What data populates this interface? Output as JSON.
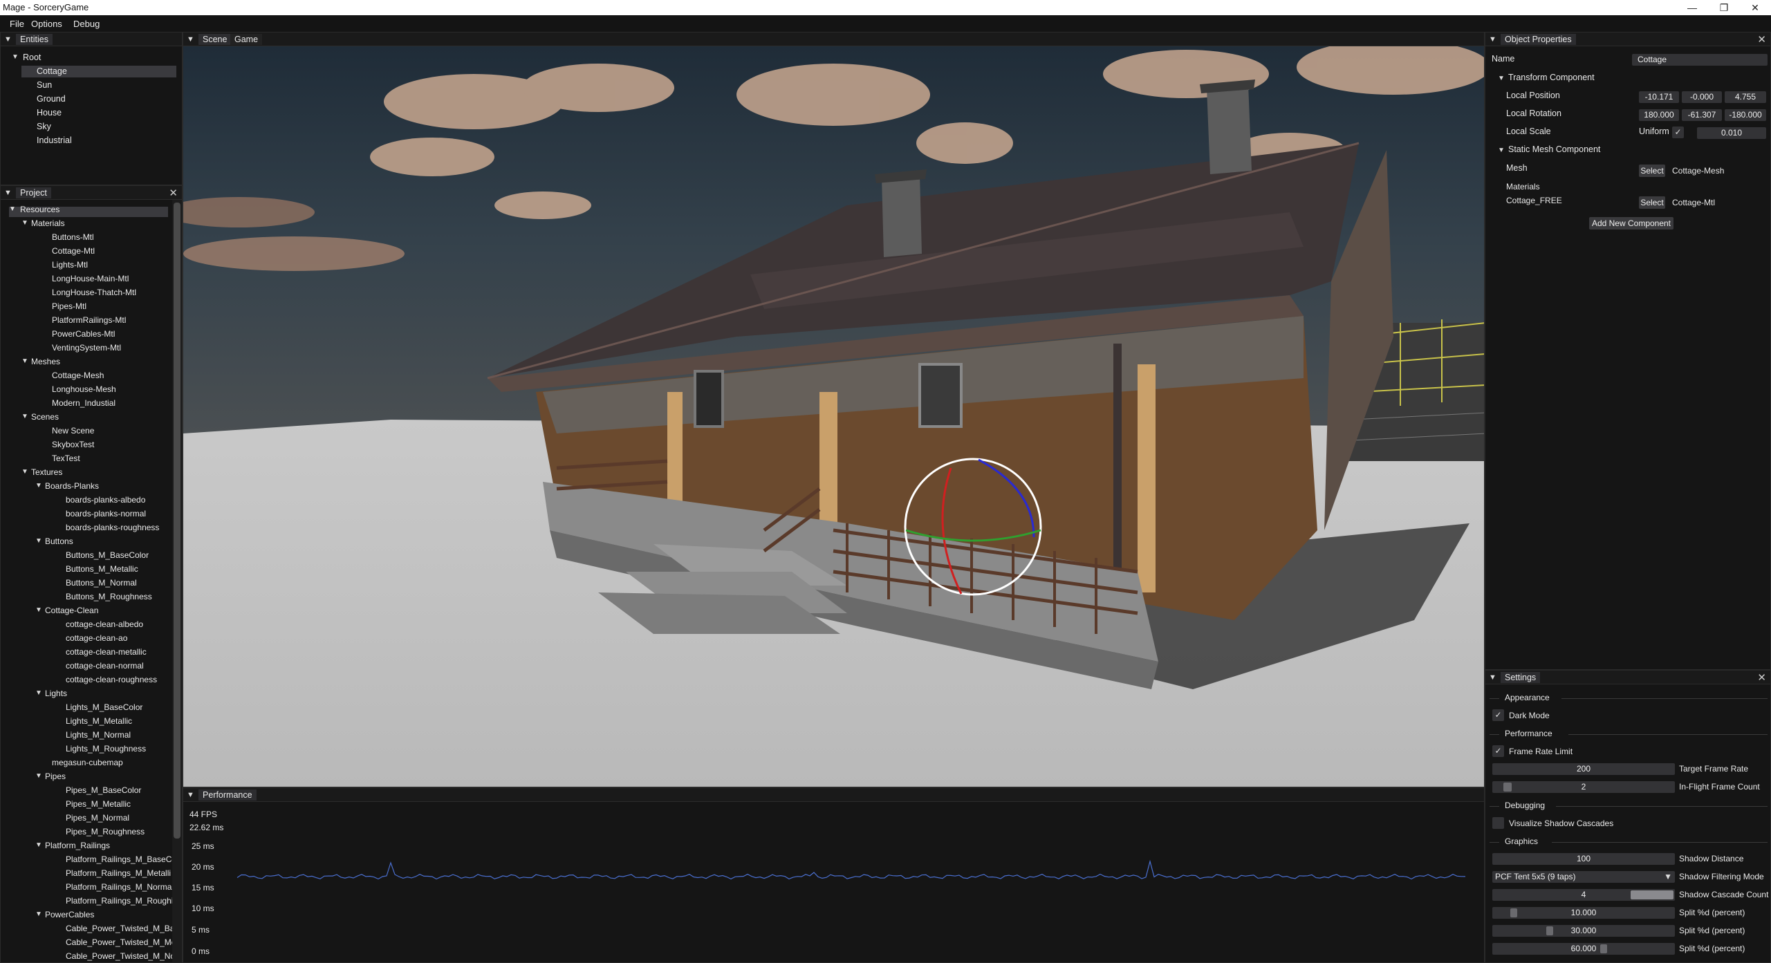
{
  "window": {
    "title": "Mage - SorceryGame",
    "minimize": "—",
    "maximize": "❐",
    "close": "✕"
  },
  "menubar": {
    "items": [
      "File",
      "Options",
      "Debug"
    ]
  },
  "entities": {
    "tab": "Entities",
    "items": [
      "Root",
      "Cottage",
      "Sun",
      "Ground",
      "House",
      "Sky",
      "Industrial"
    ],
    "selected": "Cottage"
  },
  "project": {
    "tab": "Project",
    "rows": [
      {
        "label": "Resources",
        "depth": 0,
        "arrow": true
      },
      {
        "label": "Materials",
        "depth": 1,
        "arrow": true
      },
      {
        "label": "Buttons-Mtl",
        "depth": 2
      },
      {
        "label": "Cottage-Mtl",
        "depth": 2
      },
      {
        "label": "Lights-Mtl",
        "depth": 2
      },
      {
        "label": "LongHouse-Main-Mtl",
        "depth": 2
      },
      {
        "label": "LongHouse-Thatch-Mtl",
        "depth": 2
      },
      {
        "label": "Pipes-Mtl",
        "depth": 2
      },
      {
        "label": "PlatformRailings-Mtl",
        "depth": 2
      },
      {
        "label": "PowerCables-Mtl",
        "depth": 2
      },
      {
        "label": "VentingSystem-Mtl",
        "depth": 2
      },
      {
        "label": "Meshes",
        "depth": 1,
        "arrow": true
      },
      {
        "label": "Cottage-Mesh",
        "depth": 2
      },
      {
        "label": "Longhouse-Mesh",
        "depth": 2
      },
      {
        "label": "Modern_Industial",
        "depth": 2
      },
      {
        "label": "Scenes",
        "depth": 1,
        "arrow": true
      },
      {
        "label": "New Scene",
        "depth": 2
      },
      {
        "label": "SkyboxTest",
        "depth": 2
      },
      {
        "label": "TexTest",
        "depth": 2
      },
      {
        "label": "Textures",
        "depth": 1,
        "arrow": true
      },
      {
        "label": "Boards-Planks",
        "depth": 2,
        "arrow": true
      },
      {
        "label": "boards-planks-albedo",
        "depth": 3
      },
      {
        "label": "boards-planks-normal",
        "depth": 3
      },
      {
        "label": "boards-planks-roughness",
        "depth": 3
      },
      {
        "label": "Buttons",
        "depth": 2,
        "arrow": true
      },
      {
        "label": "Buttons_M_BaseColor",
        "depth": 3
      },
      {
        "label": "Buttons_M_Metallic",
        "depth": 3
      },
      {
        "label": "Buttons_M_Normal",
        "depth": 3
      },
      {
        "label": "Buttons_M_Roughness",
        "depth": 3
      },
      {
        "label": "Cottage-Clean",
        "depth": 2,
        "arrow": true
      },
      {
        "label": "cottage-clean-albedo",
        "depth": 3
      },
      {
        "label": "cottage-clean-ao",
        "depth": 3
      },
      {
        "label": "cottage-clean-metallic",
        "depth": 3
      },
      {
        "label": "cottage-clean-normal",
        "depth": 3
      },
      {
        "label": "cottage-clean-roughness",
        "depth": 3
      },
      {
        "label": "Lights",
        "depth": 2,
        "arrow": true
      },
      {
        "label": "Lights_M_BaseColor",
        "depth": 3
      },
      {
        "label": "Lights_M_Metallic",
        "depth": 3
      },
      {
        "label": "Lights_M_Normal",
        "depth": 3
      },
      {
        "label": "Lights_M_Roughness",
        "depth": 3
      },
      {
        "label": "megasun-cubemap",
        "depth": 2
      },
      {
        "label": "Pipes",
        "depth": 2,
        "arrow": true
      },
      {
        "label": "Pipes_M_BaseColor",
        "depth": 3
      },
      {
        "label": "Pipes_M_Metallic",
        "depth": 3
      },
      {
        "label": "Pipes_M_Normal",
        "depth": 3
      },
      {
        "label": "Pipes_M_Roughness",
        "depth": 3
      },
      {
        "label": "Platform_Railings",
        "depth": 2,
        "arrow": true
      },
      {
        "label": "Platform_Railings_M_BaseCc",
        "depth": 3
      },
      {
        "label": "Platform_Railings_M_Metalli",
        "depth": 3
      },
      {
        "label": "Platform_Railings_M_Norma",
        "depth": 3
      },
      {
        "label": "Platform_Railings_M_Roughi",
        "depth": 3
      },
      {
        "label": "PowerCables",
        "depth": 2,
        "arrow": true
      },
      {
        "label": "Cable_Power_Twisted_M_Ba:",
        "depth": 3
      },
      {
        "label": "Cable_Power_Twisted_M_Me",
        "depth": 3
      },
      {
        "label": "Cable_Power_Twisted_M_No",
        "depth": 3
      }
    ]
  },
  "viewport": {
    "tabs": [
      "Scene",
      "Game"
    ],
    "active": "Scene"
  },
  "performance": {
    "tab": "Performance",
    "fps": "44 FPS",
    "frame_time": "22.62 ms",
    "axis": [
      "25 ms",
      "20 ms",
      "15 ms",
      "10 ms",
      "5 ms",
      "0 ms"
    ],
    "line_color": "#4a6fd0"
  },
  "inspector": {
    "tab": "Object Properties",
    "name_label": "Name",
    "name_value": "Cottage",
    "transform": {
      "header": "Transform Component",
      "position_label": "Local Position",
      "position": [
        "-10.171",
        "-0.000",
        "4.755"
      ],
      "rotation_label": "Local Rotation",
      "rotation": [
        "180.000",
        "-61.307",
        "-180.000"
      ],
      "scale_label": "Local Scale",
      "uniform_label": "Uniform",
      "uniform_checked": true,
      "scale": "0.010"
    },
    "mesh": {
      "header": "Static Mesh Component",
      "mesh_label": "Mesh",
      "select": "Select",
      "mesh_value": "Cottage-Mesh",
      "materials_label": "Materials",
      "material_slot": "Cottage_FREE",
      "material_value": "Cottage-Mtl"
    },
    "add_component": "Add New Component"
  },
  "settings": {
    "tab": "Settings",
    "appearance": "Appearance",
    "dark_mode": "Dark Mode",
    "performance": "Performance",
    "frame_rate_limit": "Frame Rate Limit",
    "target_frame_rate_value": "200",
    "target_frame_rate": "Target Frame Rate",
    "inflight_value": "2",
    "inflight": "In-Flight Frame Count",
    "debugging": "Debugging",
    "visualize_cascades": "Visualize Shadow Cascades",
    "graphics": "Graphics",
    "shadow_distance_value": "100",
    "shadow_distance": "Shadow Distance",
    "filter_mode_value": "PCF Tent 5x5 (9 taps)",
    "filter_mode": "Shadow Filtering Mode",
    "cascade_count_value": "4",
    "cascade_count": "Shadow Cascade Count",
    "split1_value": "10.000",
    "split2_value": "30.000",
    "split3_value": "60.000",
    "split_label": "Split %d (percent)"
  }
}
